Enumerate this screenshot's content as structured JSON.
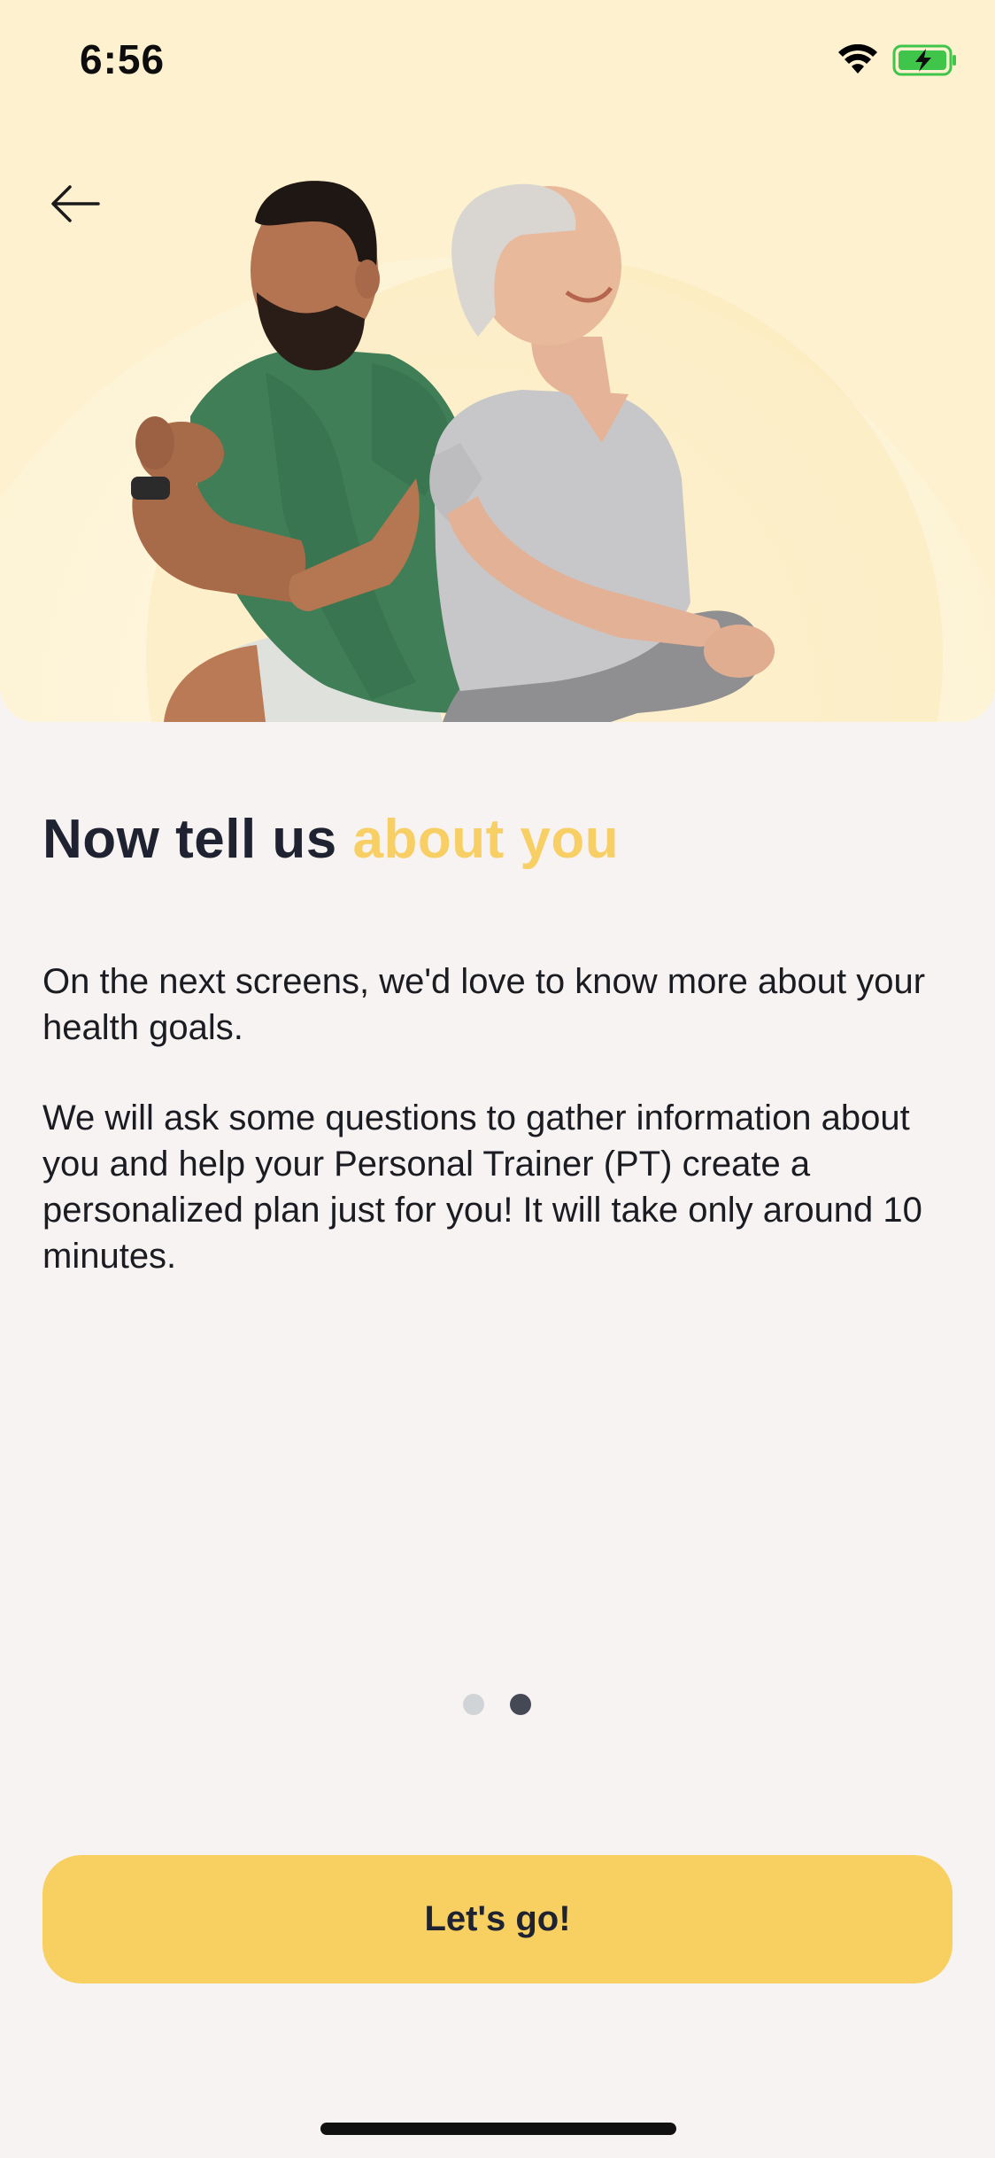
{
  "status_bar": {
    "time": "6:56",
    "icons": [
      "wifi-icon",
      "battery-charging-icon"
    ],
    "battery_color": "#3fc54a"
  },
  "navigation": {
    "back_icon": "arrow-left-icon"
  },
  "hero": {
    "image": "two-people-exercising-photo",
    "background_color": "#fdf1cf"
  },
  "content": {
    "title_main": "Now tell us ",
    "title_accent": "about you",
    "accent_color": "#f7cf64",
    "paragraph_1": "On the next screens, we'd love to know more about your health goals.",
    "paragraph_2": "We will ask some questions to gather information about you and help your Personal Trainer (PT) create a personalized plan just for you! It will take only around 10 minutes."
  },
  "pager": {
    "total": 2,
    "active_index": 1
  },
  "cta": {
    "label": "Let's go!",
    "color": "#f8d062"
  }
}
